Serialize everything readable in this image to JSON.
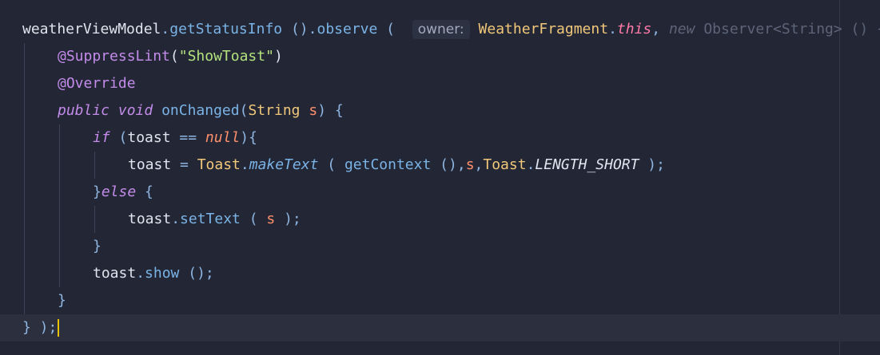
{
  "editor": {
    "lines": [
      {
        "indent": 0,
        "tokens": [
          {
            "text": "weatherViewModel",
            "cls": "id"
          },
          {
            "text": ".",
            "cls": "punct"
          },
          {
            "text": "getStatusInfo",
            "cls": "method"
          },
          {
            "text": " ().",
            "cls": "punct"
          },
          {
            "text": "observe",
            "cls": "method"
          },
          {
            "text": " (  ",
            "cls": "punct"
          },
          {
            "text": "owner:",
            "cls": "hint"
          },
          {
            "text": " ",
            "cls": "id"
          },
          {
            "text": "WeatherFragment",
            "cls": "type"
          },
          {
            "text": ".",
            "cls": "punct"
          },
          {
            "text": "this",
            "cls": "this"
          },
          {
            "text": ", ",
            "cls": "punct"
          },
          {
            "text": "new",
            "cls": "faded-kw"
          },
          {
            "text": " Observer<String> () {",
            "cls": "faded"
          }
        ]
      },
      {
        "indent": 1,
        "tokens": [
          {
            "text": "@SuppressLint",
            "cls": "annot"
          },
          {
            "text": "(",
            "cls": "id"
          },
          {
            "text": "\"ShowToast\"",
            "cls": "str"
          },
          {
            "text": ")",
            "cls": "id"
          }
        ]
      },
      {
        "indent": 1,
        "tokens": [
          {
            "text": "@Override",
            "cls": "annot"
          }
        ]
      },
      {
        "indent": 1,
        "tokens": [
          {
            "text": "public",
            "cls": "kw"
          },
          {
            "text": " ",
            "cls": "id"
          },
          {
            "text": "void",
            "cls": "kw"
          },
          {
            "text": " ",
            "cls": "id"
          },
          {
            "text": "onChanged",
            "cls": "method"
          },
          {
            "text": "(",
            "cls": "punct"
          },
          {
            "text": "String",
            "cls": "type"
          },
          {
            "text": " ",
            "cls": "id"
          },
          {
            "text": "s",
            "cls": "param"
          },
          {
            "text": ") {",
            "cls": "punct"
          }
        ]
      },
      {
        "indent": 2,
        "tokens": [
          {
            "text": "if",
            "cls": "kw"
          },
          {
            "text": " (",
            "cls": "punct"
          },
          {
            "text": "toast",
            "cls": "id"
          },
          {
            "text": " == ",
            "cls": "punct"
          },
          {
            "text": "null",
            "cls": "nul"
          },
          {
            "text": "){",
            "cls": "punct"
          }
        ]
      },
      {
        "indent": 3,
        "tokens": [
          {
            "text": "toast",
            "cls": "id"
          },
          {
            "text": " = ",
            "cls": "punct"
          },
          {
            "text": "Toast",
            "cls": "type"
          },
          {
            "text": ".",
            "cls": "punct"
          },
          {
            "text": "makeText",
            "cls": "static-m"
          },
          {
            "text": " ( ",
            "cls": "punct"
          },
          {
            "text": "getContext",
            "cls": "method"
          },
          {
            "text": " (),",
            "cls": "punct"
          },
          {
            "text": "s",
            "cls": "param"
          },
          {
            "text": ",",
            "cls": "punct"
          },
          {
            "text": "Toast",
            "cls": "type"
          },
          {
            "text": ".",
            "cls": "punct"
          },
          {
            "text": "LENGTH_SHORT",
            "cls": "const"
          },
          {
            "text": " );",
            "cls": "punct"
          }
        ]
      },
      {
        "indent": 2,
        "tokens": [
          {
            "text": "}",
            "cls": "punct"
          },
          {
            "text": "else",
            "cls": "kw"
          },
          {
            "text": " {",
            "cls": "punct"
          }
        ]
      },
      {
        "indent": 3,
        "tokens": [
          {
            "text": "toast",
            "cls": "id"
          },
          {
            "text": ".",
            "cls": "punct"
          },
          {
            "text": "setText",
            "cls": "method"
          },
          {
            "text": " ( ",
            "cls": "punct"
          },
          {
            "text": "s",
            "cls": "param"
          },
          {
            "text": " );",
            "cls": "punct"
          }
        ]
      },
      {
        "indent": 2,
        "tokens": [
          {
            "text": "}",
            "cls": "punct"
          }
        ]
      },
      {
        "indent": 2,
        "tokens": [
          {
            "text": "toast",
            "cls": "id"
          },
          {
            "text": ".",
            "cls": "punct"
          },
          {
            "text": "show",
            "cls": "method"
          },
          {
            "text": " ();",
            "cls": "punct"
          }
        ]
      },
      {
        "indent": 1,
        "tokens": [
          {
            "text": "}",
            "cls": "punct"
          }
        ]
      },
      {
        "indent": 0,
        "current": true,
        "tokens": [
          {
            "text": "} );",
            "cls": "punct"
          }
        ]
      }
    ]
  }
}
